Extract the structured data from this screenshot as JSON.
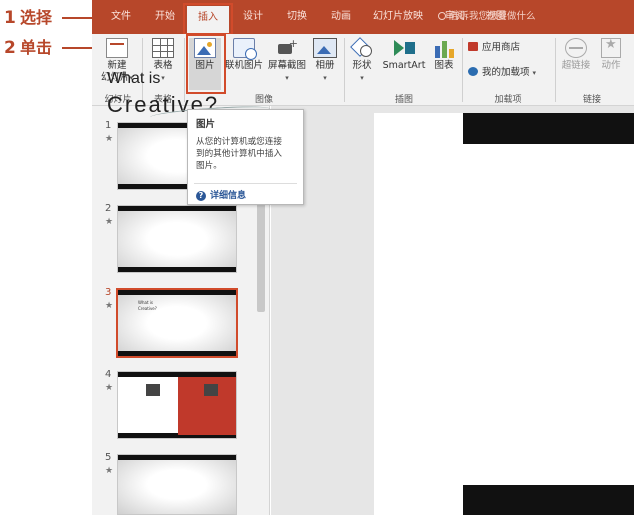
{
  "annotations": {
    "step1_num": "1",
    "step1_text": "选择",
    "step2_num": "2",
    "step2_text": "单击"
  },
  "tabs": [
    {
      "label": "文件"
    },
    {
      "label": "开始"
    },
    {
      "label": "插入",
      "selected": true
    },
    {
      "label": "设计"
    },
    {
      "label": "切换"
    },
    {
      "label": "动画"
    },
    {
      "label": "幻灯片放映"
    },
    {
      "label": "审阅"
    },
    {
      "label": "视图"
    }
  ],
  "tell_me": "告诉我您想要做什么",
  "ribbon": {
    "new_slide": {
      "line1": "新建",
      "line2": "幻灯片",
      "caret": "▾"
    },
    "table": {
      "label": "表格",
      "caret": "▾"
    },
    "picture": {
      "label": "图片"
    },
    "online_picture": {
      "label": "联机图片"
    },
    "screenshot": {
      "label": "屏幕截图",
      "caret": "▾"
    },
    "album": {
      "label": "相册",
      "caret": "▾"
    },
    "shapes": {
      "label": "形状",
      "caret": "▾"
    },
    "smartart": {
      "label": "SmartArt"
    },
    "chart": {
      "label": "图表"
    },
    "store": {
      "label": "应用商店"
    },
    "my_addins": {
      "label": "我的加载项",
      "caret": "▾"
    },
    "hyperlink": {
      "label": "超链接"
    },
    "action": {
      "label": "动作"
    },
    "groups": {
      "slides": "幻灯片",
      "tables": "表格",
      "images": "图像",
      "illustrations": "插图",
      "addins": "加载项",
      "links": "链接"
    }
  },
  "tooltip": {
    "title": "图片",
    "line1": "从您的计算机或您连接",
    "line2": "到的其他计算机中插入",
    "line3": "图片。",
    "more": "详细信息",
    "q_icon": "?"
  },
  "slides": [
    {
      "num": "1",
      "star": "★"
    },
    {
      "num": "2",
      "star": "★"
    },
    {
      "num": "3",
      "star": "★",
      "active": true,
      "title_a": "What is",
      "title_b": "Creative?"
    },
    {
      "num": "4",
      "star": "★"
    },
    {
      "num": "5",
      "star": "★"
    }
  ],
  "main_slide": {
    "line1": "What is",
    "line2": "Creative?"
  },
  "colors": {
    "accent": "#b7472a",
    "highlight": "#d14b2b",
    "ribbon_bg": "#f2f2f2"
  }
}
